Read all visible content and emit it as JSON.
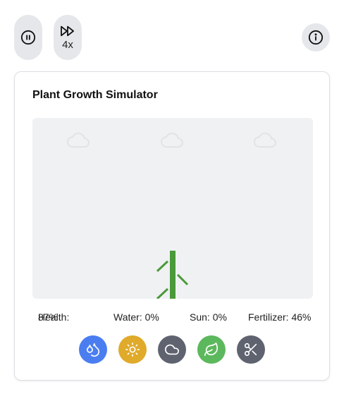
{
  "controls": {
    "pause_icon": "pause-circle-icon",
    "speed_icon": "fast-forward-icon",
    "speed_label": "4x",
    "info_icon": "info-icon"
  },
  "card": {
    "title": "Plant Growth Simulator"
  },
  "stage": {
    "clouds": [
      "cloud-icon",
      "cloud-icon",
      "cloud-icon"
    ],
    "plant_color": "#4a9a3a"
  },
  "stats": {
    "health_label": "Health:",
    "health_value": "87%",
    "water_label": "Water:",
    "water_value": "0%",
    "sun_label": "Sun:",
    "sun_value": "0%",
    "fertilizer_label": "Fertilizer:",
    "fertilizer_value": "46%"
  },
  "actions": [
    {
      "name": "water",
      "icon": "droplets-icon",
      "color": "#4a7ef0"
    },
    {
      "name": "sun",
      "icon": "sun-icon",
      "color": "#e0aa2a"
    },
    {
      "name": "cloud",
      "icon": "cloud-icon",
      "color": "#5f6370"
    },
    {
      "name": "fertilize",
      "icon": "leaf-icon",
      "color": "#5cb85c"
    },
    {
      "name": "prune",
      "icon": "scissors-icon",
      "color": "#5f6370"
    }
  ]
}
